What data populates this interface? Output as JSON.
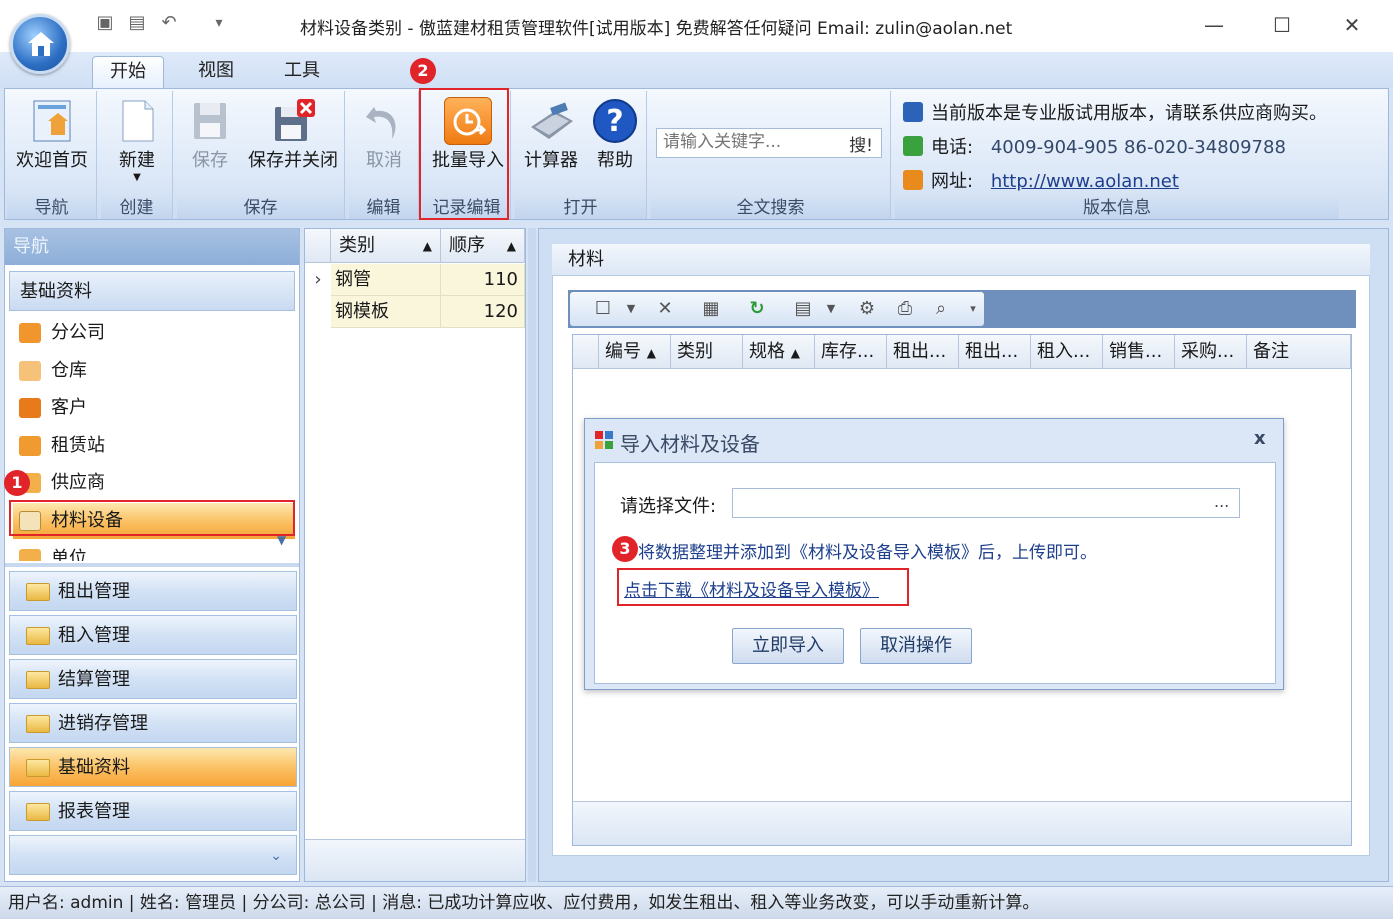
{
  "window": {
    "title": "材料设备类别 - 傲蓝建材租赁管理软件[试用版本] 免费解答任何疑问 Email: zulin@aolan.net",
    "quick_access_dropdown": "▾"
  },
  "tabs": [
    {
      "label": "开始"
    },
    {
      "label": "视图"
    },
    {
      "label": "工具"
    }
  ],
  "ribbon": {
    "groups": {
      "nav": "导航",
      "create": "创建",
      "save": "保存",
      "edit": "编辑",
      "record_edit": "记录编辑",
      "open": "打开",
      "search": "全文搜索",
      "version": "版本信息"
    },
    "buttons": {
      "home": "欢迎首页",
      "new": "新建",
      "save": "保存",
      "save_close": "保存并关闭",
      "cancel": "取消",
      "batch_import": "批量导入",
      "calculator": "计算器",
      "help": "帮助"
    },
    "search": {
      "placeholder": "请输入关键字...",
      "button": "搜!"
    },
    "info": {
      "notice": "当前版本是专业版试用版本，请联系供应商购买。",
      "phone_label": "电话:",
      "phone_values": "4009-904-905  86-020-34809788",
      "site_label": "网址:",
      "site_url": "http://www.aolan.net"
    }
  },
  "badges": {
    "one": "1",
    "two": "2",
    "three": "3"
  },
  "nav": {
    "header": "导航",
    "subheader": "基础资料",
    "items": [
      {
        "label": "分公司"
      },
      {
        "label": "仓库"
      },
      {
        "label": "客户"
      },
      {
        "label": "租赁站"
      },
      {
        "label": "供应商"
      },
      {
        "label": "材料设备"
      },
      {
        "label": "单位"
      }
    ],
    "sections": [
      {
        "label": "租出管理"
      },
      {
        "label": "租入管理"
      },
      {
        "label": "结算管理"
      },
      {
        "label": "进销存管理"
      },
      {
        "label": "基础资料"
      },
      {
        "label": "报表管理"
      }
    ]
  },
  "category_grid": {
    "columns": [
      "类别",
      "顺序"
    ],
    "rows": [
      {
        "name": "钢管",
        "order": "110"
      },
      {
        "name": "钢模板",
        "order": "120"
      }
    ]
  },
  "materials": {
    "title": "材料",
    "columns": [
      "编号",
      "类别",
      "规格",
      "库存...",
      "租出...",
      "租出...",
      "租入...",
      "销售...",
      "采购...",
      "备注"
    ]
  },
  "dialog": {
    "title": "导入材料及设备",
    "file_label": "请选择文件:",
    "file_value": "",
    "browse": "...",
    "hint": "将数据整理并添加到《材料及设备导入模板》后，上传即可。",
    "download_link": "点击下载《材料及设备导入模板》",
    "import_button": "立即导入",
    "cancel_button": "取消操作",
    "close": "x"
  },
  "status": {
    "text": "用户名: admin  | 姓名: 管理员  | 分公司: 总公司  | 消息: 已成功计算应收、应付费用，如发生租出、租入等业务改变，可以手动重新计算。"
  },
  "colors": {
    "accent_orange": "#f6a434",
    "highlight_red": "#e0242a",
    "ribbon_blue": "#dbe7f7"
  }
}
